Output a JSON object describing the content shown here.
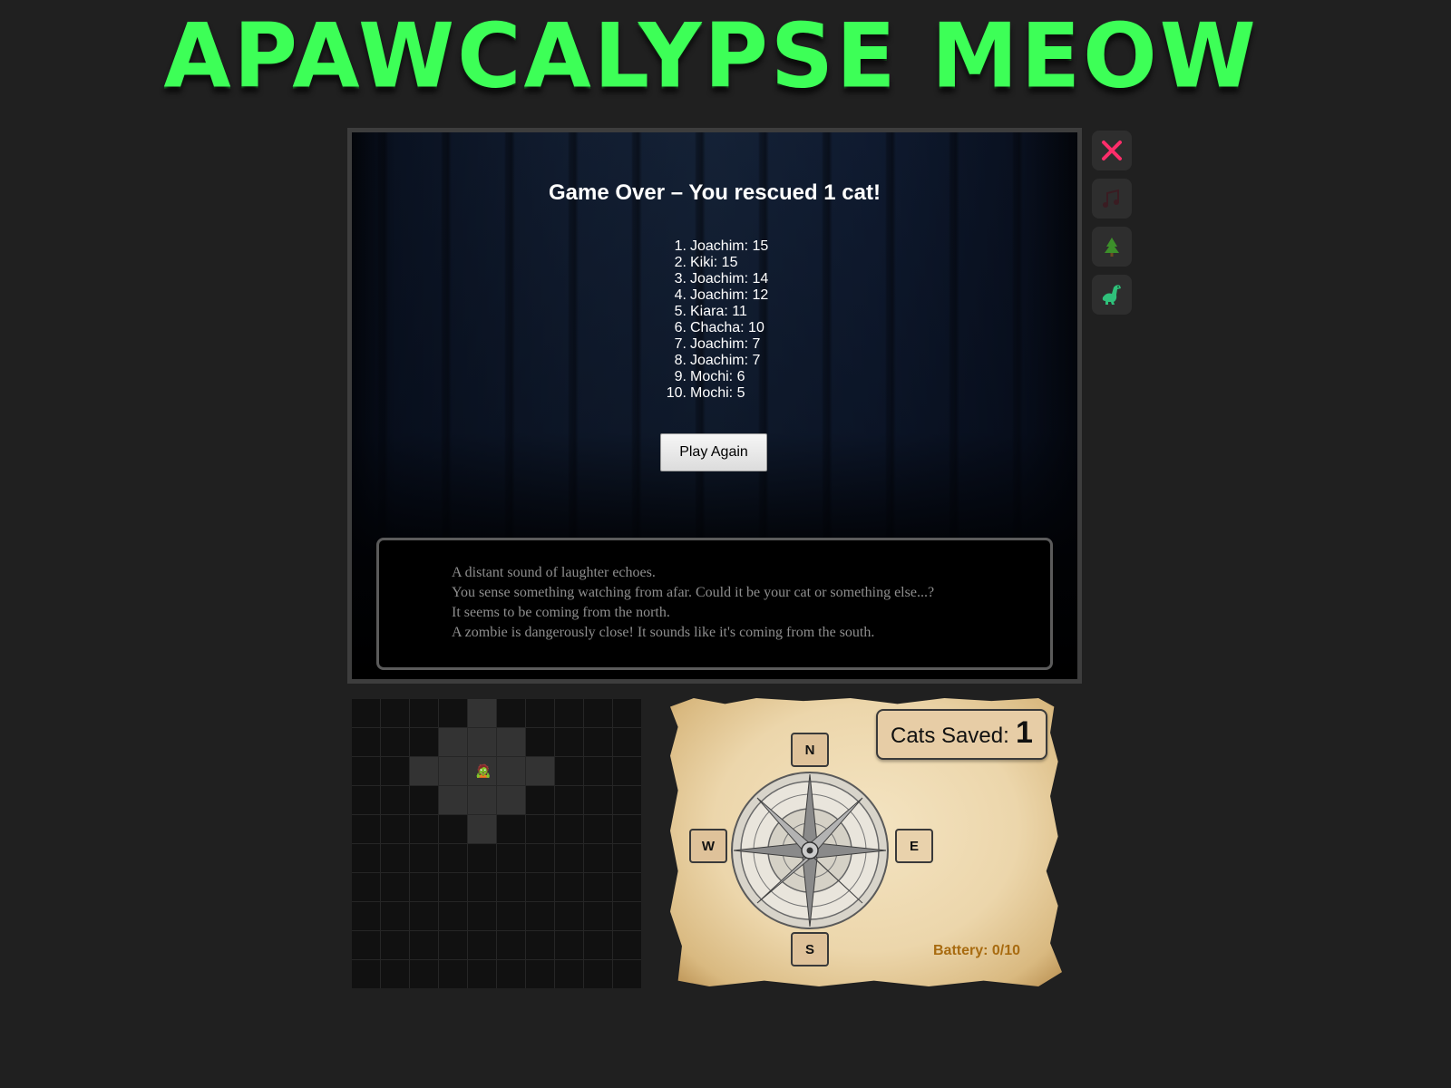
{
  "title": "APAWCALYPSE MEOW",
  "game_over": {
    "message": "Game Over – You rescued 1 cat!",
    "leaderboard": [
      {
        "rank": "1.",
        "entry": "Joachim: 15"
      },
      {
        "rank": "2.",
        "entry": "Kiki: 15"
      },
      {
        "rank": "3.",
        "entry": "Joachim: 14"
      },
      {
        "rank": "4.",
        "entry": "Joachim: 12"
      },
      {
        "rank": "5.",
        "entry": "Kiara: 11"
      },
      {
        "rank": "6.",
        "entry": "Chacha: 10"
      },
      {
        "rank": "7.",
        "entry": "Joachim: 7"
      },
      {
        "rank": "8.",
        "entry": "Joachim: 7"
      },
      {
        "rank": "9.",
        "entry": "Mochi: 6"
      },
      {
        "rank": "10.",
        "entry": "Mochi: 5"
      }
    ],
    "play_again_label": "Play Again"
  },
  "log": [
    "A distant sound of laughter echoes.",
    "You sense something watching from afar. Could it be your cat or something else...?",
    "It seems to be coming from the north.",
    "A zombie is dangerously close! It sounds like it's coming from the south."
  ],
  "side_buttons": [
    {
      "name": "close-icon",
      "glyph": "✕",
      "color": "#ff2d6a"
    },
    {
      "name": "music-icon",
      "glyph": "♫",
      "color": "#3a1c22"
    },
    {
      "name": "tree-icon",
      "glyph": "♣",
      "color": "#3c8f2a"
    },
    {
      "name": "dinosaur-icon",
      "glyph": "🦖",
      "color": "#2fc07a"
    }
  ],
  "map": {
    "rows": 10,
    "cols": 10,
    "lit_cells": [
      [
        0,
        4
      ],
      [
        1,
        3
      ],
      [
        1,
        4
      ],
      [
        1,
        5
      ],
      [
        2,
        2
      ],
      [
        2,
        3
      ],
      [
        2,
        4
      ],
      [
        2,
        5
      ],
      [
        2,
        6
      ],
      [
        3,
        3
      ],
      [
        3,
        4
      ],
      [
        3,
        5
      ],
      [
        4,
        4
      ]
    ],
    "player": {
      "row": 2,
      "col": 4,
      "glyph": "🧟"
    }
  },
  "navigation": {
    "north": "N",
    "south": "S",
    "west": "W",
    "east": "E"
  },
  "status": {
    "cats_saved_label": "Cats Saved:",
    "cats_saved_value": "1",
    "battery_text": "Battery: 0/10"
  },
  "colors": {
    "title_green": "#3dff57",
    "background": "#202020",
    "battery": "#a86b10",
    "close": "#ff2d6a"
  }
}
